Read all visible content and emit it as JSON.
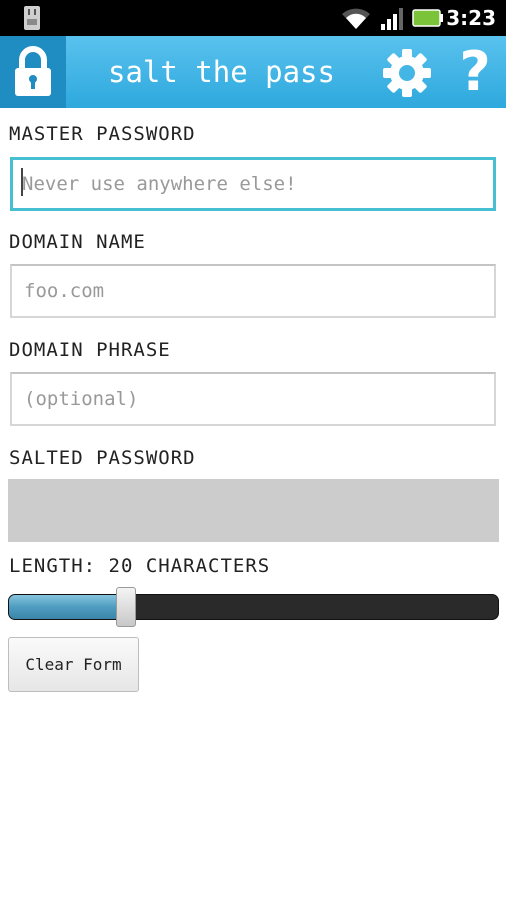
{
  "status_bar": {
    "time": "3:23",
    "icons": [
      "usb-icon",
      "wifi-icon",
      "signal-icon",
      "battery-icon"
    ],
    "battery_color": "#7bc43a"
  },
  "app_bar": {
    "title": "salt the pass",
    "icons": [
      "lock-icon",
      "gear-icon",
      "help-icon"
    ],
    "help_glyph": "?",
    "color": "#3db3e6"
  },
  "form": {
    "master_password": {
      "label": "MASTER PASSWORD",
      "placeholder": "Never use anywhere else!",
      "value": ""
    },
    "domain_name": {
      "label": "DOMAIN NAME",
      "placeholder": "foo.com",
      "value": ""
    },
    "domain_phrase": {
      "label": "DOMAIN PHRASE",
      "placeholder": "(optional)",
      "value": ""
    },
    "salted_password": {
      "label": "SALTED PASSWORD",
      "value": ""
    },
    "length": {
      "label": "LENGTH: 20 CHARACTERS",
      "value": 20,
      "slider_fraction": 0.24
    },
    "clear_button_label": "Clear Form"
  }
}
